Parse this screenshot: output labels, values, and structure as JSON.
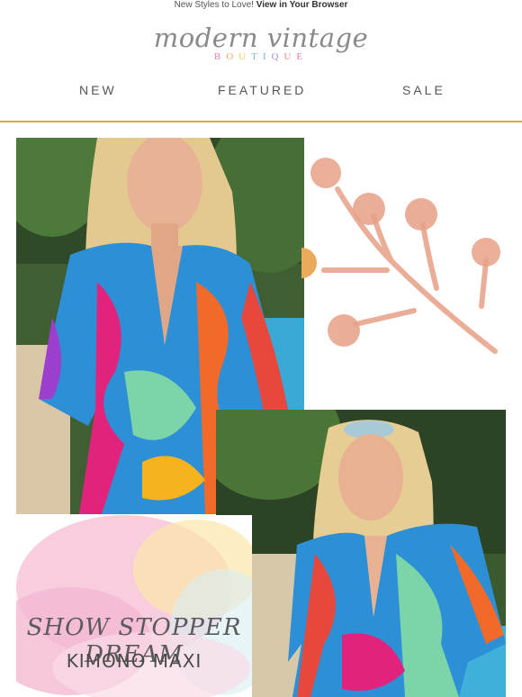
{
  "preheader": {
    "text": "New Styles to Love! ",
    "link": "View in Your Browser"
  },
  "logo": {
    "script": "modern vintage",
    "letters": [
      "B",
      "O",
      "U",
      "T",
      "I",
      "Q",
      "U",
      "E"
    ],
    "letter_colors": [
      "#e67ab8",
      "#f2a65a",
      "#f5cd4a",
      "#6fc7a6",
      "#6ab6e3",
      "#9d8fe0",
      "#f08c8c",
      "#e67ab8"
    ]
  },
  "nav": {
    "items": [
      "NEW",
      "FEATURED",
      "SALE"
    ]
  },
  "colors": {
    "divider": "#d4b23a",
    "text": "#555555",
    "flower": "#e7a187"
  },
  "banner": {
    "line1": "SHOW STOPPER DREAM",
    "line2": "KIMONO MAXI"
  }
}
